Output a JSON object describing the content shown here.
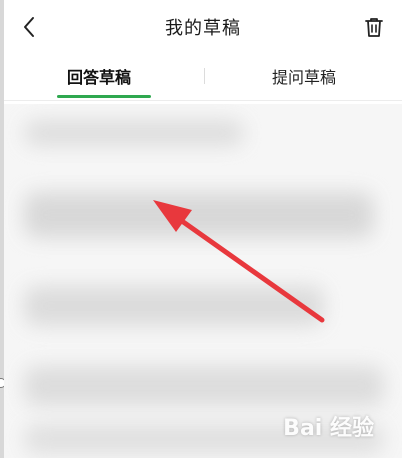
{
  "header": {
    "title": "我的草稿",
    "back_icon": "chevron-left-icon",
    "delete_icon": "trash-icon"
  },
  "tabs": [
    {
      "label": "回答草稿",
      "active": true
    },
    {
      "label": "提问草稿",
      "active": false
    }
  ],
  "colors": {
    "accent": "#2fa84f",
    "arrow": "#e8383d"
  },
  "watermark": {
    "text": "Bai 经验"
  }
}
